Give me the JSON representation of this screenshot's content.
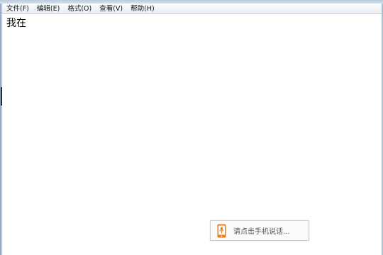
{
  "menubar": {
    "items": [
      {
        "label": "文件(F)"
      },
      {
        "label": "编辑(E)"
      },
      {
        "label": "格式(O)"
      },
      {
        "label": "查看(V)"
      },
      {
        "label": "帮助(H)"
      }
    ]
  },
  "editor": {
    "text": "我在"
  },
  "voice_hint": {
    "label": "请点击手机说话...",
    "icon": "microphone-phone-icon",
    "accent_color": "#f07a18"
  }
}
